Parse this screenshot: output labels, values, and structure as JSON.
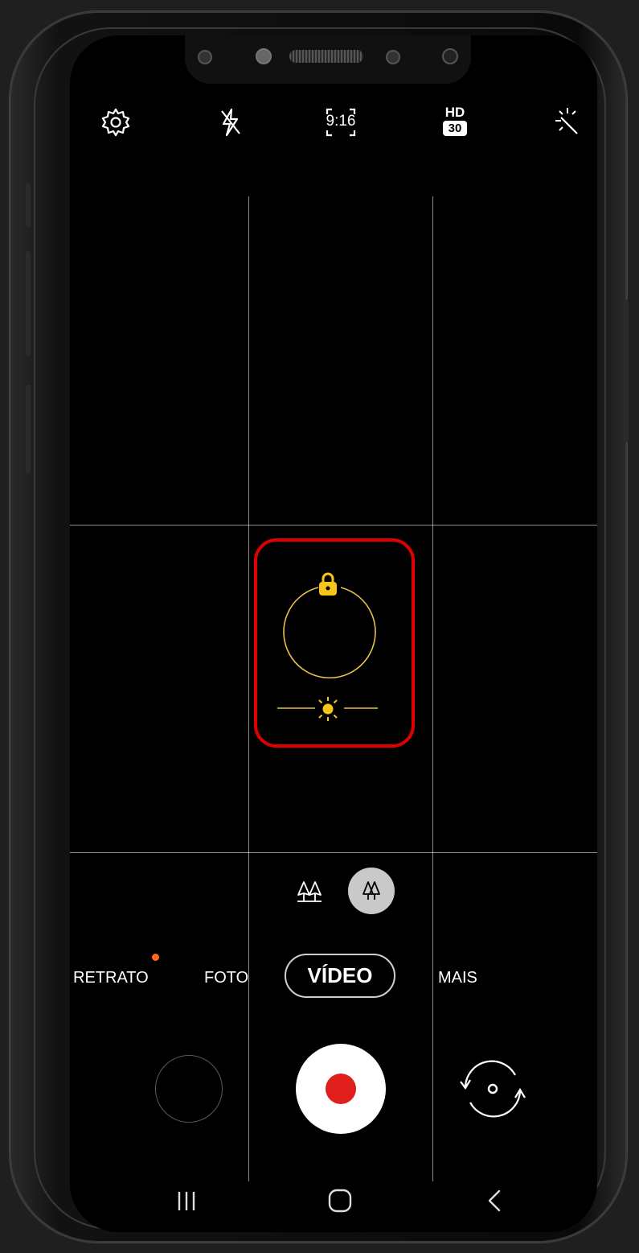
{
  "topbar": {
    "icons": [
      "settings-icon",
      "flash-off-icon",
      "aspect-ratio-icon",
      "video-quality-icon",
      "filters-icon"
    ],
    "aspect_ratio_label": "9:16",
    "quality_label": "HD",
    "fps_label": "30"
  },
  "lens_selector": {
    "icons": [
      "wide-angle-icon",
      "standard-lens-icon"
    ],
    "selected": "standard-lens-icon"
  },
  "modes": {
    "portrait": "RETRATO",
    "photo": "FOTO",
    "video": "VÍDEO",
    "more": "MAIS",
    "selected": "VÍDEO"
  },
  "focus": {
    "locked": true,
    "accent_color": "#f5c518",
    "highlight_color": "#e00000"
  },
  "navbar": {
    "icons": [
      "recent-apps-icon",
      "home-icon",
      "back-icon"
    ]
  }
}
